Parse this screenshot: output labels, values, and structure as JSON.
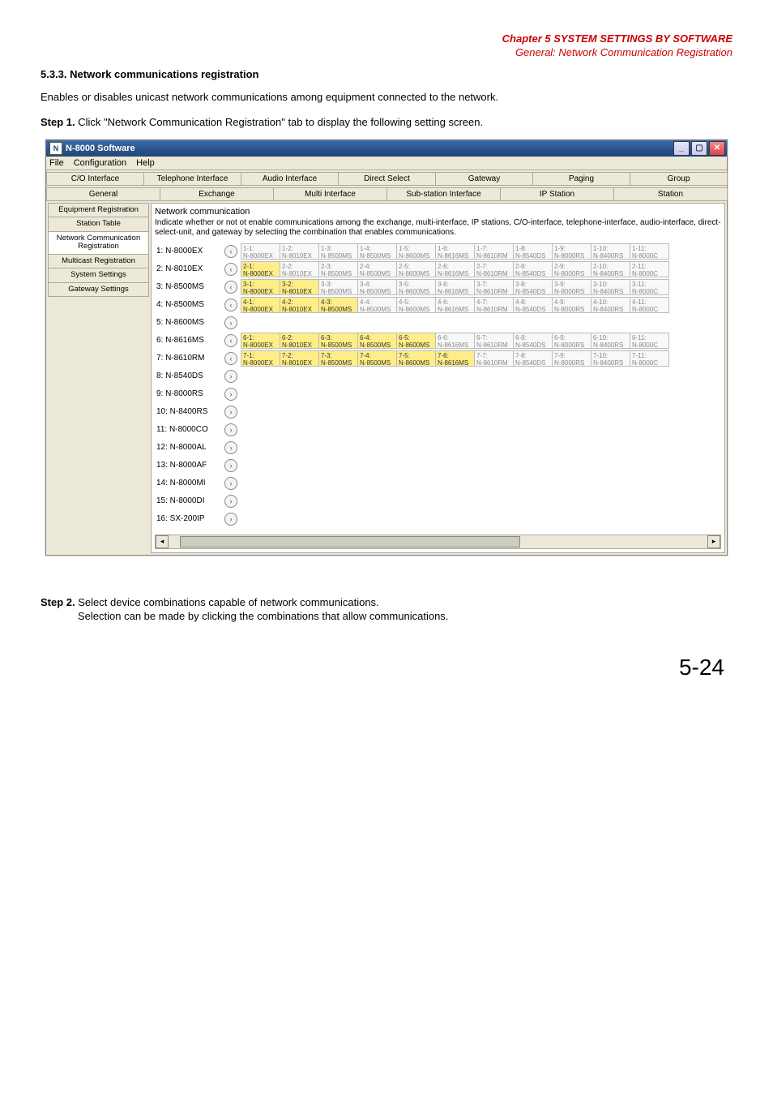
{
  "header": {
    "chapter": "Chapter 5  SYSTEM SETTINGS BY SOFTWARE",
    "subtitle": "General: Network Communication Registration"
  },
  "section_heading": "5.3.3. Network communications registration",
  "intro": "Enables or disables unicast network communications among equipment connected to the network.",
  "step1_label": "Step 1.",
  "step1_text": "Click \"Network Communication Registration\" tab to display the following setting screen.",
  "step2_label": "Step 2.",
  "step2_text": "Select device combinations capable of network communications.",
  "step2_sub": "Selection can be made by clicking the combinations that allow communications.",
  "page_number": "5-24",
  "app": {
    "title": "N-8000 Software",
    "menus": [
      "File",
      "Configuration",
      "Help"
    ],
    "top_tabs_row1": [
      "C/O Interface",
      "Telephone Interface",
      "Audio Interface",
      "Direct Select",
      "Gateway",
      "Paging",
      "Group"
    ],
    "top_tabs_row2": [
      "General",
      "Exchange",
      "Multi Interface",
      "Sub-station Interface",
      "IP Station",
      "Station"
    ],
    "side_tabs": [
      "Equipment Registration",
      "Station Table",
      "Network Communication Registration",
      "Multicast Registration",
      "System Settings",
      "Gateway Settings"
    ],
    "pane_title": "Network communication",
    "pane_desc": "Indicate whether or not ot enable communications among the exchange, multi-interface, IP stations, C/O-interface, telephone-interface, audio-interface, direct-select-unit, and gateway by selecting the combination that enables communications.",
    "device_rows": [
      {
        "label": "1: N-8000EX",
        "arrow": "left",
        "hl": 0,
        "cells": [
          "1-1:\nN-8000EX",
          "1-2:\nN-8010EX",
          "1-3:\nN-8500MS",
          "1-4:\nN-8500MS",
          "1-5:\nN-8600MS",
          "1-6:\nN-8616MS",
          "1-7:\nN-8610RM",
          "1-8:\nN-8540DS",
          "1-9:\nN-8000RS",
          "1-10:\nN-8400RS",
          "1-11:\nN-8000C"
        ]
      },
      {
        "label": "2: N-8010EX",
        "arrow": "left",
        "hl": 1,
        "cells": [
          "2-1:\nN-8000EX",
          "2-2:\nN-8010EX",
          "2-3:\nN-8500MS",
          "2-4:\nN-8500MS",
          "2-5:\nN-8600MS",
          "2-6:\nN-8616MS",
          "2-7:\nN-8610RM",
          "2-8:\nN-8540DS",
          "2-9:\nN-8000RS",
          "2-10:\nN-8400RS",
          "2-11:\nN-8000C"
        ]
      },
      {
        "label": "3: N-8500MS",
        "arrow": "left",
        "hl": 2,
        "cells": [
          "3-1:\nN-8000EX",
          "3-2:\nN-8010EX",
          "3-3:\nN-8500MS",
          "3-4:\nN-8500MS",
          "3-5:\nN-8600MS",
          "3-6:\nN-8616MS",
          "3-7:\nN-8610RM",
          "3-8:\nN-8540DS",
          "3-9:\nN-8000RS",
          "3-10:\nN-8400RS",
          "3-11:\nN-8000C"
        ]
      },
      {
        "label": "4: N-8500MS",
        "arrow": "left",
        "hl": 3,
        "cells": [
          "4-1:\nN-8000EX",
          "4-2:\nN-8010EX",
          "4-3:\nN-8500MS",
          "4-4:\nN-8500MS",
          "4-5:\nN-8600MS",
          "4-6:\nN-8616MS",
          "4-7:\nN-8610RM",
          "4-8:\nN-8540DS",
          "4-9:\nN-8000RS",
          "4-10:\nN-8400RS",
          "4-11:\nN-8000C"
        ]
      },
      {
        "label": "5: N-8600MS",
        "arrow": "right",
        "hl": -1,
        "cells": []
      },
      {
        "label": "6: N-8616MS",
        "arrow": "left",
        "hl": 5,
        "cells": [
          "6-1:\nN-8000EX",
          "6-2:\nN-8010EX",
          "6-3:\nN-8500MS",
          "6-4:\nN-8500MS",
          "6-5:\nN-8600MS",
          "6-6:\nN-8616MS",
          "6-7:\nN-8610RM",
          "6-8:\nN-8540DS",
          "6-9:\nN-8000RS",
          "6-10:\nN-8400RS",
          "6-11:\nN-8000C"
        ]
      },
      {
        "label": "7: N-8610RM",
        "arrow": "left",
        "hl": 6,
        "cells": [
          "7-1:\nN-8000EX",
          "7-2:\nN-8010EX",
          "7-3:\nN-8500MS",
          "7-4:\nN-8500MS",
          "7-5:\nN-8600MS",
          "7-6:\nN-8616MS",
          "7-7:\nN-8610RM",
          "7-8:\nN-8540DS",
          "7-9:\nN-8000RS",
          "7-10:\nN-8400RS",
          "7-11:\nN-8000C"
        ]
      },
      {
        "label": "8: N-8540DS",
        "arrow": "right",
        "hl": -1,
        "cells": []
      },
      {
        "label": "9: N-8000RS",
        "arrow": "right",
        "hl": -1,
        "cells": []
      },
      {
        "label": "10: N-8400RS",
        "arrow": "right",
        "hl": -1,
        "cells": []
      },
      {
        "label": "11: N-8000CO",
        "arrow": "right",
        "hl": -1,
        "cells": []
      },
      {
        "label": "12: N-8000AL",
        "arrow": "right",
        "hl": -1,
        "cells": []
      },
      {
        "label": "13: N-8000AF",
        "arrow": "right",
        "hl": -1,
        "cells": []
      },
      {
        "label": "14: N-8000MI",
        "arrow": "right",
        "hl": -1,
        "cells": []
      },
      {
        "label": "15: N-8000DI",
        "arrow": "right",
        "hl": -1,
        "cells": []
      },
      {
        "label": "16: SX-200IP",
        "arrow": "right",
        "hl": -1,
        "cells": []
      }
    ]
  }
}
